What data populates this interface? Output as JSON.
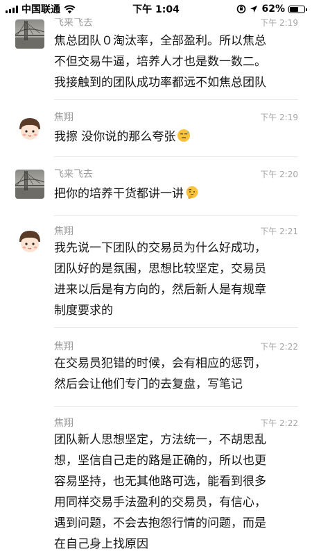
{
  "status_bar": {
    "carrier": "中国联通",
    "time": "下午 1:04",
    "battery_percent": "62%",
    "battery_level": 0.62
  },
  "messages": [
    {
      "sender": "飞来飞去",
      "time": "下午 2:19",
      "avatar_icon": "bridge-avatar",
      "lines": [
        "焦总团队０淘汰率，全部盈利。所以焦总",
        "不但交易牛逼，培养人才也是数一数二。",
        "我接触到的团队成功率都远不如焦总团队"
      ]
    },
    {
      "sender": "焦翔",
      "time": "下午 2:19",
      "avatar_icon": "cartoon-face-avatar",
      "lines": [
        "我擦 没你说的那么夸张"
      ],
      "emoji": "sweat-smile-emoji"
    },
    {
      "sender": "飞来飞去",
      "time": "下午 2:20",
      "avatar_icon": "bridge-avatar",
      "lines": [
        "把你的培养干货都讲一讲"
      ],
      "emoji": "thinking-emoji"
    },
    {
      "sender": "焦翔",
      "time": "下午 2:21",
      "avatar_icon": "cartoon-face-avatar",
      "lines": [
        "我先说一下团队的交易员为什么好成功，",
        "团队好的是氛围，思想比较坚定，交易员",
        "进来以后是有方向的，然后新人是有规章",
        "制度要求的"
      ]
    },
    {
      "sender": "焦翔",
      "time": "下午 2:22",
      "lines": [
        "在交易员犯错的时候，会有相应的惩罚，",
        "然后会让他们专门的去复盘，写笔记"
      ]
    },
    {
      "sender": "焦翔",
      "time": "下午 2:22",
      "lines": [
        "团队新人思想坚定，方法统一，不胡思乱",
        "想，坚信自己走的路是正确的，所以也更",
        "容易坚持，也无其他路可选，能看到很多",
        "用同样交易手法盈利的交易员，有信心，",
        "遇到问题，不会去抱怨行情的问题，而是",
        "在自己身上找原因"
      ]
    }
  ]
}
